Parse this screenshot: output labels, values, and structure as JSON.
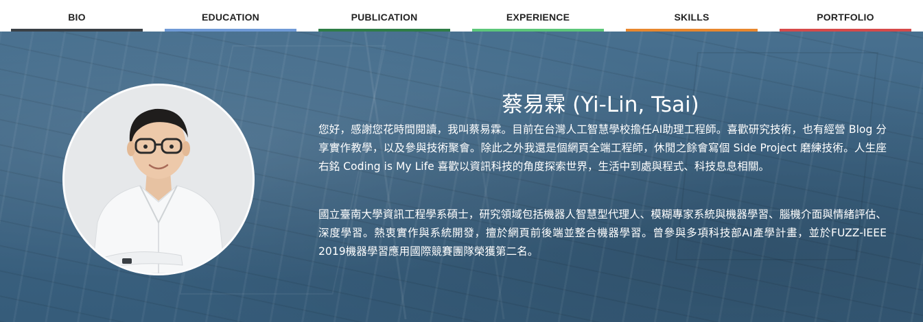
{
  "nav": {
    "items": [
      {
        "label": "BIO",
        "color": "#3a4046"
      },
      {
        "label": "EDUCATION",
        "color": "#6f9ad6"
      },
      {
        "label": "PUBLICATION",
        "color": "#2e7d46"
      },
      {
        "label": "EXPERIENCE",
        "color": "#5cc77a"
      },
      {
        "label": "SKILLS",
        "color": "#e8872e"
      },
      {
        "label": "PORTFOLIO",
        "color": "#d64a4a"
      }
    ]
  },
  "profile": {
    "name": "蔡易霖 (Yi-Lin, Tsai)",
    "bio_paragraphs": [
      "您好，感謝您花時間閱讀，我叫蔡易霖。目前在台灣人工智慧學校擔任AI助理工程師。喜歡研究技術，也有經營 Blog 分享實作教學，以及參與技術聚會。除此之外我還是個網頁全端工程師，休閒之餘會寫個 Side Project 磨練技術。人生座右銘 Coding is My Life 喜歡以資訊科技的角度探索世界，生活中到處與程式、科技息息相關。",
      "國立臺南大學資訊工程學系碩士，研究領域包括機器人智慧型代理人、模糊專家系統與機器學習、腦機介面與情緒評估、深度學習。熱衷實作與系統開發，擅於網頁前後端並整合機器學習。曾參與多項科技部AI產學計畫，並於FUZZ-IEEE 2019機器學習應用國際競賽團隊榮獲第二名。"
    ]
  },
  "colors": {
    "hero_bg": "#3d6382",
    "text": "#ffffff"
  }
}
